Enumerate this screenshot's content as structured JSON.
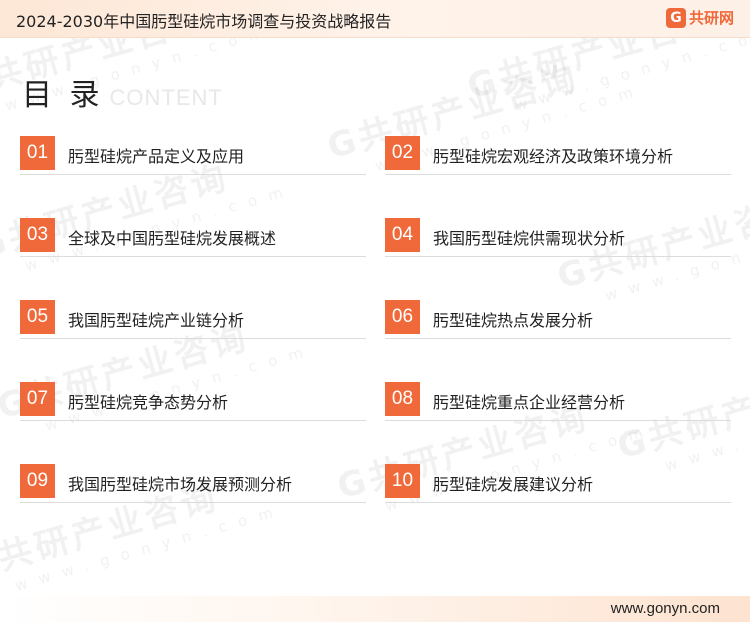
{
  "header": {
    "report_title": "2024-2030年中国肟型硅烷市场调查与投资战略报告",
    "brand_mark": "G",
    "brand_text": "共研网"
  },
  "toc": {
    "title": "目 录",
    "subtitle": "CONTENT",
    "items": [
      {
        "number": "01",
        "label": "肟型硅烷产品定义及应用"
      },
      {
        "number": "02",
        "label": "肟型硅烷宏观经济及政策环境分析"
      },
      {
        "number": "03",
        "label": "全球及中国肟型硅烷发展概述"
      },
      {
        "number": "04",
        "label": "我国肟型硅烷供需现状分析"
      },
      {
        "number": "05",
        "label": "我国肟型硅烷产业链分析"
      },
      {
        "number": "06",
        "label": "肟型硅烷热点发展分析"
      },
      {
        "number": "07",
        "label": "肟型硅烷竞争态势分析"
      },
      {
        "number": "08",
        "label": "肟型硅烷重点企业经营分析"
      },
      {
        "number": "09",
        "label": "我国肟型硅烷市场发展预测分析"
      },
      {
        "number": "10",
        "label": "肟型硅烷发展建议分析"
      }
    ]
  },
  "watermark": {
    "main": "G共研产业咨询",
    "sub": "www.gonyn.com"
  },
  "footer": {
    "url": "www.gonyn.com"
  },
  "colors": {
    "accent": "#f0693a",
    "header_bg": "#fde7d6",
    "divider": "#dcdcdc"
  }
}
